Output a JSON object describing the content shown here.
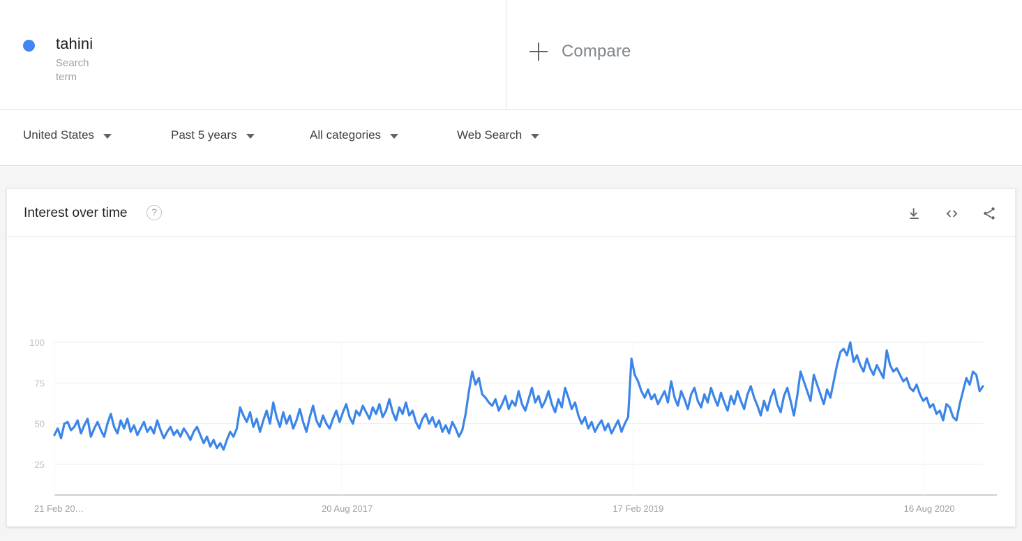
{
  "term": {
    "name": "tahini",
    "subtitle": "Search term",
    "dot_color": "#4285f4"
  },
  "compare": {
    "label": "Compare",
    "icon": "plus-icon"
  },
  "filters": [
    {
      "label": "United States",
      "icon": "chevron-down-icon"
    },
    {
      "label": "Past 5 years",
      "icon": "chevron-down-icon"
    },
    {
      "label": "All categories",
      "icon": "chevron-down-icon"
    },
    {
      "label": "Web Search",
      "icon": "chevron-down-icon"
    }
  ],
  "card": {
    "title": "Interest over time",
    "help_icon": "?",
    "actions": [
      {
        "name": "download-icon",
        "tooltip": "Download"
      },
      {
        "name": "embed-code-icon",
        "tooltip": "Embed"
      },
      {
        "name": "share-icon",
        "tooltip": "Share"
      }
    ]
  },
  "chart_data": {
    "type": "line",
    "title": "Interest over time",
    "xlabel": "",
    "ylabel": "",
    "ylim": [
      0,
      108
    ],
    "yticks": [
      25,
      50,
      75,
      100
    ],
    "grid": true,
    "legend": false,
    "line_color": "#3b85e8",
    "xtick_labels": [
      "21 Feb 20…",
      "20 Aug 2017",
      "17 Feb 2019",
      "16 Aug 2020"
    ],
    "xtick_positions": [
      0,
      0.3096,
      0.6231,
      0.9366
    ],
    "series": [
      {
        "name": "tahini",
        "values": [
          43,
          47,
          41,
          50,
          51,
          46,
          48,
          52,
          44,
          49,
          53,
          42,
          47,
          51,
          46,
          42,
          50,
          56,
          48,
          44,
          52,
          47,
          53,
          45,
          49,
          43,
          47,
          51,
          45,
          48,
          44,
          52,
          46,
          41,
          45,
          48,
          43,
          46,
          42,
          47,
          44,
          40,
          45,
          48,
          43,
          38,
          42,
          36,
          40,
          35,
          38,
          34,
          40,
          45,
          42,
          47,
          60,
          55,
          51,
          57,
          48,
          53,
          45,
          52,
          58,
          50,
          63,
          54,
          48,
          57,
          50,
          55,
          47,
          52,
          59,
          51,
          45,
          54,
          61,
          52,
          48,
          55,
          50,
          47,
          53,
          58,
          51,
          57,
          62,
          54,
          50,
          58,
          55,
          61,
          57,
          53,
          60,
          56,
          62,
          54,
          58,
          65,
          57,
          52,
          60,
          56,
          63,
          55,
          58,
          51,
          47,
          53,
          56,
          50,
          54,
          48,
          52,
          45,
          49,
          44,
          51,
          47,
          42,
          46,
          56,
          70,
          82,
          74,
          78,
          68,
          66,
          63,
          61,
          65,
          58,
          62,
          67,
          59,
          64,
          61,
          70,
          62,
          58,
          65,
          72,
          63,
          67,
          60,
          64,
          70,
          62,
          57,
          65,
          60,
          72,
          66,
          59,
          63,
          55,
          50,
          54,
          47,
          51,
          45,
          49,
          52,
          46,
          50,
          44,
          48,
          52,
          45,
          50,
          54,
          90,
          80,
          76,
          70,
          66,
          71,
          65,
          68,
          62,
          66,
          70,
          63,
          76,
          66,
          61,
          70,
          65,
          59,
          68,
          72,
          64,
          60,
          68,
          63,
          72,
          66,
          61,
          69,
          63,
          58,
          67,
          62,
          70,
          64,
          59,
          68,
          73,
          66,
          61,
          55,
          64,
          58,
          66,
          71,
          62,
          57,
          67,
          72,
          64,
          55,
          67,
          82,
          76,
          70,
          64,
          80,
          74,
          68,
          62,
          71,
          66,
          76,
          86,
          94,
          96,
          92,
          100,
          88,
          92,
          86,
          82,
          90,
          84,
          80,
          86,
          82,
          78,
          95,
          86,
          82,
          84,
          80,
          76,
          78,
          72,
          70,
          74,
          68,
          64,
          66,
          60,
          62,
          56,
          58,
          52,
          62,
          60,
          54,
          52,
          62,
          70,
          78,
          74,
          82,
          80,
          70,
          73
        ]
      }
    ]
  }
}
